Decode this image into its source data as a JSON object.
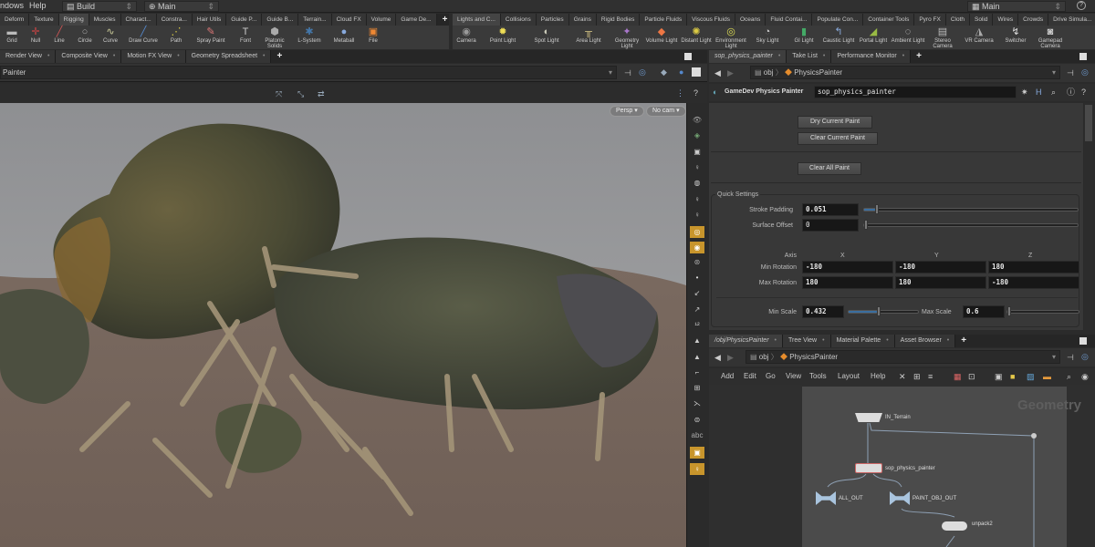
{
  "menubar": {
    "items": [
      "ndows",
      "Help"
    ],
    "desktop_left": "Build",
    "desktop_mid": "Main",
    "desktop_right": "Main"
  },
  "shelf_left": {
    "tabs": [
      "Deform",
      "Texture",
      "Rigging",
      "Muscles",
      "Charact...",
      "Constra...",
      "Hair Utils",
      "Guide P...",
      "Guide B...",
      "Terrain...",
      "Cloud FX",
      "Volume",
      "Game De..."
    ],
    "tools": [
      "Grid",
      "Null",
      "Line",
      "Circle",
      "Curve",
      "Draw Curve",
      "Path",
      "Spray Paint",
      "Font",
      "Platonic Solids",
      "L-System",
      "Metaball",
      "File"
    ]
  },
  "shelf_right": {
    "tabs": [
      "Lights and C...",
      "Collisions",
      "Particles",
      "Grains",
      "Rigid Bodies",
      "Particle Fluids",
      "Viscous Fluids",
      "Oceans",
      "Fluid Contai...",
      "Populate Con...",
      "Container Tools",
      "Pyro FX",
      "Cloth",
      "Solid",
      "Wires",
      "Crowds",
      "Drive Simula..."
    ],
    "tools": [
      "Camera",
      "Point Light",
      "Spot Light",
      "Area Light",
      "Geometry Light",
      "Volume Light",
      "Distant Light",
      "Environment Light",
      "Sky Light",
      "GI Light",
      "Caustic Light",
      "Portal Light",
      "Ambient Light",
      "Stereo Camera",
      "VR Camera",
      "Switcher",
      "Gamepad Camera"
    ]
  },
  "viewer": {
    "tabs": [
      "Render View",
      "Composite View",
      "Motion FX View",
      "Geometry Spreadsheet"
    ],
    "path_label": "Painter",
    "persp_label": "Persp",
    "cam_label": "No cam"
  },
  "params": {
    "tabs": [
      "sop_physics_painter",
      "Take List",
      "Performance Monitor"
    ],
    "path_obj": "obj",
    "path_node": "PhysicsPainter",
    "node_type": "GameDev Physics Painter",
    "node_name": "sop_physics_painter",
    "buttons": {
      "dry": "Dry Current Paint",
      "clear_current": "Clear Current Paint",
      "clear_all": "Clear All Paint"
    },
    "section": "Quick Settings",
    "stroke_padding": {
      "label": "Stroke Padding",
      "value": "0.051",
      "fraction": 0.05
    },
    "surface_offset": {
      "label": "Surface Offset",
      "value": "0",
      "fraction": 0.0
    },
    "axis": {
      "label": "Axis",
      "x": "X",
      "y": "Y",
      "z": "Z"
    },
    "min_rotation": {
      "label": "Min Rotation",
      "x": "-180",
      "y": "-180",
      "z": "180"
    },
    "max_rotation": {
      "label": "Max Rotation",
      "x": "180",
      "y": "180",
      "z": "-180"
    },
    "min_scale": {
      "label": "Min Scale",
      "value": "0.432",
      "fraction": 0.43
    },
    "max_scale": {
      "label": "Max Scale",
      "value": "0.6",
      "fraction": 0.0
    }
  },
  "network": {
    "tabs": [
      "/obj/PhysicsPainter",
      "Tree View",
      "Material Palette",
      "Asset Browser"
    ],
    "path_obj": "obj",
    "path_node": "PhysicsPainter",
    "menu": [
      "Add",
      "Edit",
      "Go",
      "View",
      "Tools",
      "Layout",
      "Help"
    ],
    "context_label": "Geometry",
    "nodes": [
      "IN_Terrain",
      "sop_physics_painter",
      "ALL_OUT",
      "PAINT_OBJ_OUT",
      "unpack2"
    ]
  }
}
